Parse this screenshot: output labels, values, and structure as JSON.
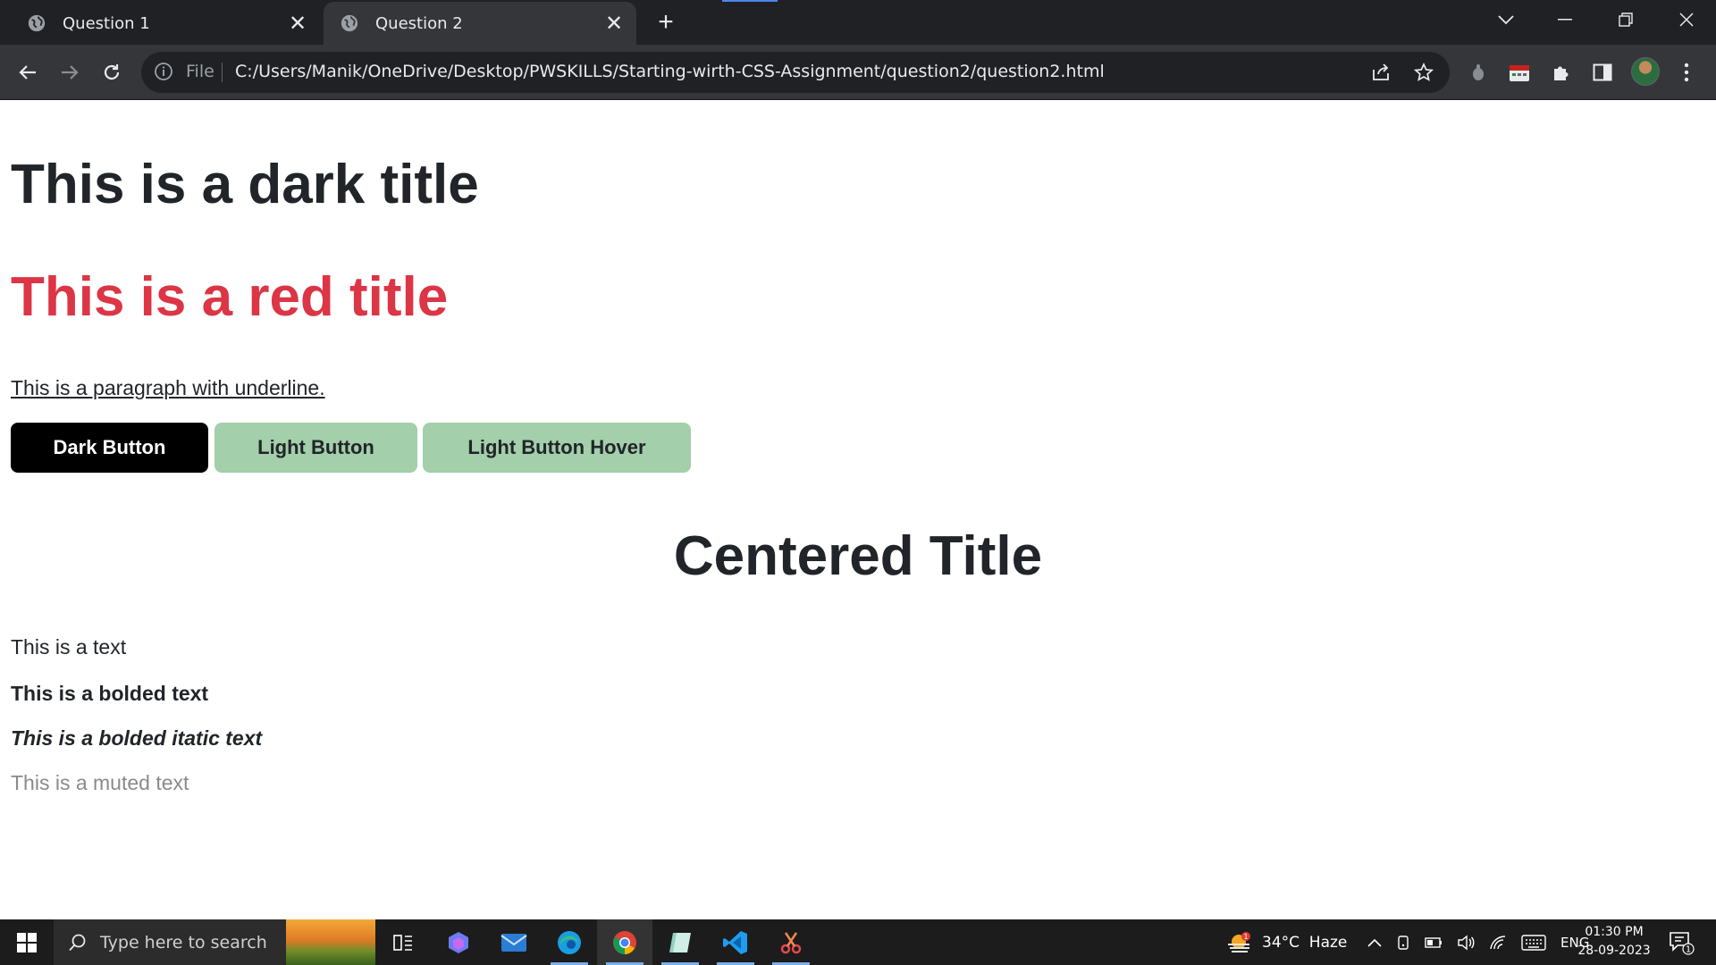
{
  "browser": {
    "tabs": [
      {
        "title": "Question 1",
        "active": false
      },
      {
        "title": "Question 2",
        "active": true
      }
    ],
    "url_scheme": "File",
    "url": "C:/Users/Manik/OneDrive/Desktop/PWSKILLS/Starting-wirth-CSS-Assignment/question2/question2.html"
  },
  "page": {
    "dark_title": "This is a dark title",
    "red_title": "This is a red title",
    "underline_paragraph": "This is a paragraph with underline.",
    "buttons": {
      "dark": "Dark Button",
      "light": "Light Button",
      "light_hover": "Light Button Hover"
    },
    "centered_title": "Centered Title",
    "text": "This is a text",
    "bold_text": "This is a bolded text",
    "bold_italic_text": "This is a bolded itatic text",
    "muted_text": "This is a muted text"
  },
  "taskbar": {
    "search_placeholder": "Type here to search",
    "weather": "34°C  Haze",
    "weather_badge": "1",
    "language": "ENG",
    "time": "01:30 PM",
    "date": "28-09-2023",
    "notification_count": "1"
  },
  "colors": {
    "red_title": "#dc3545",
    "light_button": "#a3cfaa",
    "dark_button": "#000000",
    "muted_text": "#8a8a8a"
  }
}
